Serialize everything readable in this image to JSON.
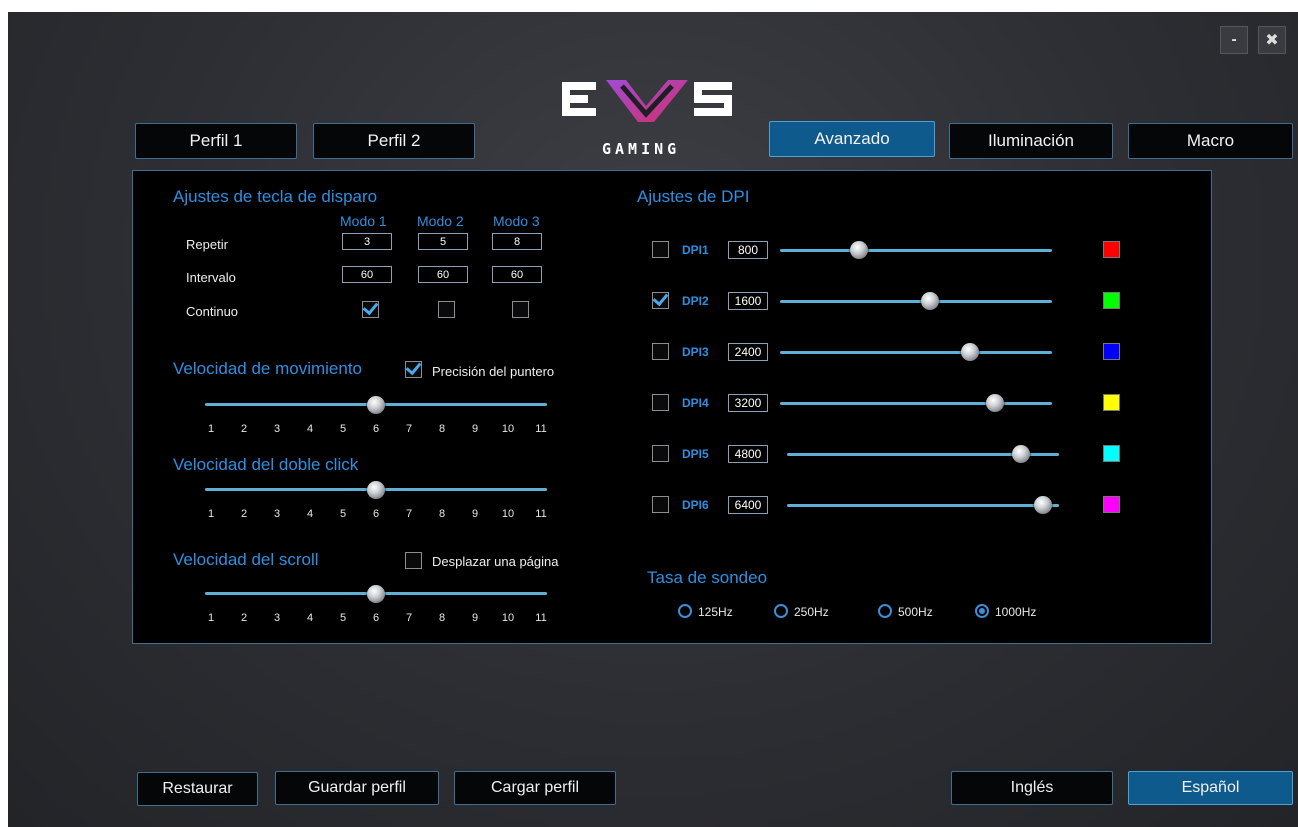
{
  "window": {
    "minimize_glyph": "-",
    "close_glyph": "✖"
  },
  "logo": {
    "text_top": "EVS",
    "text_bottom": "GAMING"
  },
  "tabs": {
    "profile1": "Perfil 1",
    "profile2": "Perfil 2",
    "advanced": "Avanzado",
    "lighting": "Iluminación",
    "macro": "Macro"
  },
  "fire_key": {
    "title": "Ajustes de tecla de disparo",
    "modes": [
      "Modo 1",
      "Modo 2",
      "Modo 3"
    ],
    "rows": {
      "repeat": {
        "label": "Repetir",
        "values": [
          "3",
          "5",
          "8"
        ]
      },
      "interval": {
        "label": "Intervalo",
        "values": [
          "60",
          "60",
          "60"
        ]
      },
      "continuous": {
        "label": "Continuo",
        "checked": [
          true,
          false,
          false
        ]
      }
    }
  },
  "movement": {
    "title": "Velocidad de movimiento",
    "pointer_precision_label": "Precisión del puntero",
    "pointer_precision_checked": true,
    "value": 6,
    "ticks": [
      "1",
      "2",
      "3",
      "4",
      "5",
      "6",
      "7",
      "8",
      "9",
      "10",
      "11"
    ]
  },
  "double_click": {
    "title": "Velocidad del doble click",
    "value": 6,
    "ticks": [
      "1",
      "2",
      "3",
      "4",
      "5",
      "6",
      "7",
      "8",
      "9",
      "10",
      "11"
    ]
  },
  "scroll": {
    "title": "Velocidad del scroll",
    "page_scroll_label": "Desplazar una página",
    "page_scroll_checked": false,
    "value": 6,
    "ticks": [
      "1",
      "2",
      "3",
      "4",
      "5",
      "6",
      "7",
      "8",
      "9",
      "10",
      "11"
    ]
  },
  "dpi": {
    "title": "Ajustes de DPI",
    "levels": [
      {
        "label": "DPI1",
        "value": "800",
        "checked": false,
        "fraction": 0.29,
        "color": "#ff0000"
      },
      {
        "label": "DPI2",
        "value": "1600",
        "checked": true,
        "fraction": 0.55,
        "color": "#00ff00"
      },
      {
        "label": "DPI3",
        "value": "2400",
        "checked": false,
        "fraction": 0.7,
        "color": "#0000ff"
      },
      {
        "label": "DPI4",
        "value": "3200",
        "checked": false,
        "fraction": 0.79,
        "color": "#ffff00"
      },
      {
        "label": "DPI5",
        "value": "4800",
        "checked": false,
        "fraction": 0.86,
        "color": "#00ffff"
      },
      {
        "label": "DPI6",
        "value": "6400",
        "checked": false,
        "fraction": 0.94,
        "color": "#ff00ff"
      }
    ]
  },
  "polling": {
    "title": "Tasa de sondeo",
    "options": [
      "125Hz",
      "250Hz",
      "500Hz",
      "1000Hz"
    ],
    "selected": "1000Hz"
  },
  "footer": {
    "restore": "Restaurar",
    "save_profile": "Guardar perfil",
    "load_profile": "Cargar perfil",
    "english": "Inglés",
    "spanish": "Español",
    "active_language": "Español"
  }
}
